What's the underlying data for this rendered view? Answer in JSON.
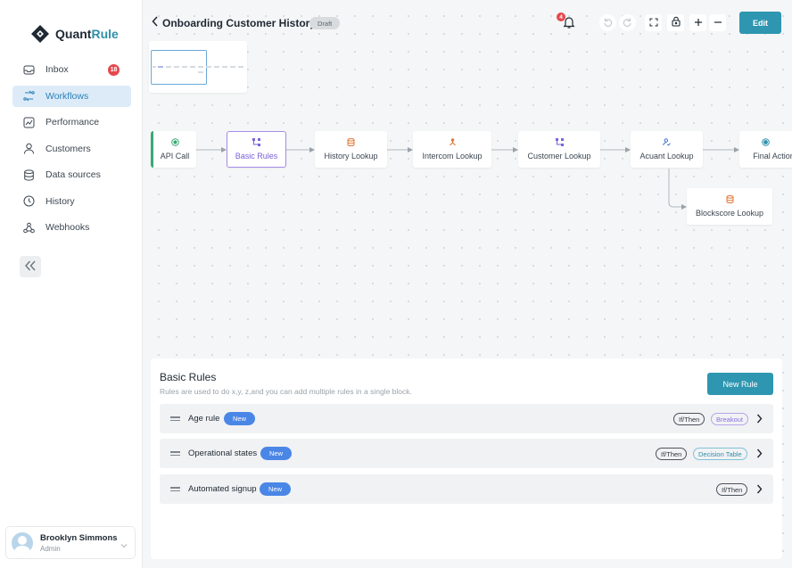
{
  "app": {
    "logo_prefix": "Quant",
    "logo_suffix": "Rule"
  },
  "sidebar": {
    "items": [
      {
        "label": "Inbox",
        "icon": "inbox-icon",
        "badge": "18"
      },
      {
        "label": "Workflows",
        "icon": "workflow-icon",
        "active": true
      },
      {
        "label": "Performance",
        "icon": "chart-icon"
      },
      {
        "label": "Customers",
        "icon": "user-icon"
      },
      {
        "label": "Data sources",
        "icon": "database-icon"
      },
      {
        "label": "History",
        "icon": "clock-icon"
      },
      {
        "label": "Webhooks",
        "icon": "webhook-icon"
      }
    ],
    "user": {
      "name": "Brooklyn Simmons",
      "role": "Admin"
    }
  },
  "header": {
    "title": "Onboarding Customer History",
    "status": "Draft",
    "notification_count": "4",
    "edit_label": "Edit"
  },
  "flow": {
    "nodes": [
      {
        "label": "API Call",
        "icon": "target-icon"
      },
      {
        "label": "Basic Rules",
        "icon": "rules-icon"
      },
      {
        "label": "History Lookup",
        "icon": "database-icon"
      },
      {
        "label": "Intercom Lookup",
        "icon": "network-icon"
      },
      {
        "label": "Customer Lookup",
        "icon": "rules-icon"
      },
      {
        "label": "Acuant Lookup",
        "icon": "user-check-icon"
      },
      {
        "label": "Final Action",
        "icon": "target-icon"
      },
      {
        "label": "Blockscore Lookup",
        "icon": "database-icon"
      }
    ]
  },
  "rules_panel": {
    "title": "Basic Rules",
    "description": "Rules are used to do x,y, z,and you can add multiple rules in a single block.",
    "new_rule_label": "New Rule",
    "rules": [
      {
        "name": "Age rule",
        "badge": "New",
        "tags": [
          "If/Then",
          "Breakout"
        ]
      },
      {
        "name": "Operational states",
        "badge": "New",
        "tags": [
          "If/Then",
          "Decision Table"
        ]
      },
      {
        "name": "Automated signup",
        "badge": "New",
        "tags": [
          "If/Then"
        ]
      }
    ]
  },
  "colors": {
    "primary": "#2e96b0",
    "active_nav": "#2a7fb8",
    "selected_node": "#7b5fd9",
    "badge_red": "#e5484d",
    "new_badge": "#4a86e6",
    "start_node": "#3aa873"
  }
}
